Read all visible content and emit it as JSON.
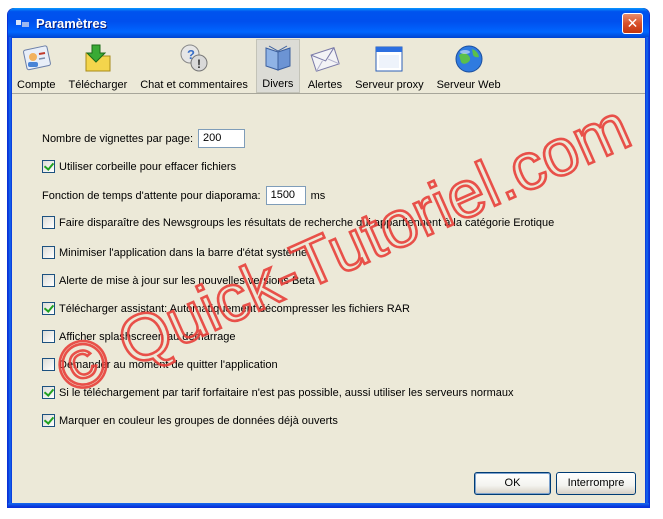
{
  "window": {
    "title": "Paramètres",
    "close_label": "✕"
  },
  "toolbar": {
    "items": [
      {
        "label": "Compte",
        "icon": "account-icon"
      },
      {
        "label": "Télécharger",
        "icon": "download-icon"
      },
      {
        "label": "Chat et commentaires",
        "icon": "chat-icon"
      },
      {
        "label": "Divers",
        "icon": "misc-icon",
        "active": true
      },
      {
        "label": "Alertes",
        "icon": "alerts-icon"
      },
      {
        "label": "Serveur proxy",
        "icon": "proxy-icon"
      },
      {
        "label": "Serveur Web",
        "icon": "web-server-icon"
      }
    ]
  },
  "settings": {
    "thumbnails": {
      "label": "Nombre de vignettes par page:",
      "value": "200"
    },
    "recycle_bin": {
      "label": "Utiliser corbeille pour effacer fichiers",
      "checked": true
    },
    "slideshow": {
      "label": "Fonction de temps d'attente pour diaporama:",
      "value": "1500",
      "unit": "ms"
    },
    "hide_erotic": {
      "label": "Faire disparaître des Newsgroups les résultats de recherche qui appartiennent à la catégorie Erotique",
      "checked": false
    },
    "minimize_tray": {
      "label": "Minimiser l'application dans la barre d'état système",
      "checked": false
    },
    "beta_alert": {
      "label": "Alerte de mise à jour sur les nouvelles versions Beta",
      "checked": false
    },
    "rar_assistant": {
      "label": "Télécharger assistant: Automatiquement décompresser les fichiers RAR",
      "checked": true
    },
    "splashscreen": {
      "label": "Afficher splashscreen au démarrage",
      "checked": false
    },
    "ask_quit": {
      "label": "Demander au moment de quitter l'application",
      "checked": false
    },
    "flat_rate": {
      "label": "Si le téléchargement par tarif forfaitaire n'est pas possible, aussi utiliser les serveurs normaux",
      "checked": true
    },
    "color_groups": {
      "label": "Marquer en couleur les groupes de données déjà ouverts",
      "checked": true
    }
  },
  "buttons": {
    "ok": "OK",
    "cancel": "Interrompre"
  },
  "watermark": {
    "text": "© Quick-Tutoriel.com",
    "color": "#e8403a"
  },
  "colors": {
    "titlebar": "#0053ee",
    "dialog_bg": "#ece9d8",
    "check": "#21a121"
  }
}
